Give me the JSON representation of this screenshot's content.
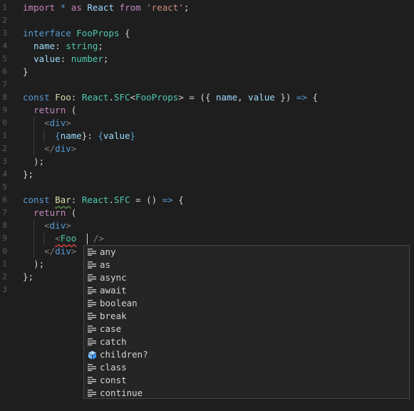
{
  "gutter": {
    "line_numbers": [
      "1",
      "2",
      "3",
      "4",
      "5",
      "6",
      "7",
      "8",
      "9",
      "0",
      "1",
      "2",
      "3",
      "4",
      "5",
      "6",
      "7",
      "8",
      "9",
      "0",
      "1",
      "2",
      "3"
    ]
  },
  "code": {
    "l1": {
      "t1": "import",
      "t2": " ",
      "t3": "*",
      "t4": " ",
      "t5": "as",
      "t6": " React ",
      "t7": "from",
      "t8": " ",
      "t9": "'react'",
      "t10": ";"
    },
    "l3": {
      "t1": "interface",
      "t2": " ",
      "t3": "FooProps",
      "t4": " {"
    },
    "l4": {
      "t1": "  ",
      "t2": "name",
      "t3": ": ",
      "t4": "string",
      "t5": ";"
    },
    "l5": {
      "t1": "  ",
      "t2": "value",
      "t3": ": ",
      "t4": "number",
      "t5": ";"
    },
    "l6": {
      "t1": "}"
    },
    "l8": {
      "t1": "const",
      "t2": " ",
      "t3": "Foo",
      "t4": ": ",
      "t5": "React",
      "t6": ".",
      "t7": "SFC",
      "t8": "<",
      "t9": "FooProps",
      "t10": "> = ({ ",
      "t11": "name",
      "t12": ", ",
      "t13": "value",
      "t14": " }) ",
      "t15": "=>",
      "t16": " {"
    },
    "l9": {
      "t1": "  ",
      "t2": "return",
      "t3": " ("
    },
    "l10": {
      "t1": "    ",
      "t2": "<",
      "t3": "div",
      "t4": ">"
    },
    "l11": {
      "t1": "      ",
      "t2": "{",
      "t3": "name",
      "t4": "}: ",
      "t5": "{",
      "t6": "value",
      "t7": "}"
    },
    "l12": {
      "t1": "    ",
      "t2": "</",
      "t3": "div",
      "t4": ">"
    },
    "l13": {
      "t1": "  );"
    },
    "l14": {
      "t1": "};"
    },
    "l16": {
      "t1": "const",
      "t2": " ",
      "t3": "Bar",
      "t4": ": ",
      "t5": "React",
      "t6": ".",
      "t7": "SFC",
      "t8": " = () ",
      "t9": "=>",
      "t10": " {"
    },
    "l17": {
      "t1": "  ",
      "t2": "return",
      "t3": " ("
    },
    "l18": {
      "t1": "    ",
      "t2": "<",
      "t3": "div",
      "t4": ">"
    },
    "l19": {
      "t1": "      ",
      "t2": "<",
      "t3": "Foo",
      "t4": "  ",
      "t5": " ",
      "t6": "/>"
    },
    "l20": {
      "t1": "    ",
      "t2": "</",
      "t3": "div",
      "t4": ">"
    },
    "l21": {
      "t1": "  );"
    },
    "l22": {
      "t1": "};"
    }
  },
  "suggestions": {
    "items": [
      {
        "label": "any",
        "icon": "keyword-icon"
      },
      {
        "label": "as",
        "icon": "keyword-icon"
      },
      {
        "label": "async",
        "icon": "keyword-icon"
      },
      {
        "label": "await",
        "icon": "keyword-icon"
      },
      {
        "label": "boolean",
        "icon": "keyword-icon"
      },
      {
        "label": "break",
        "icon": "keyword-icon"
      },
      {
        "label": "case",
        "icon": "keyword-icon"
      },
      {
        "label": "catch",
        "icon": "keyword-icon"
      },
      {
        "label": "children?",
        "icon": "property-icon"
      },
      {
        "label": "class",
        "icon": "keyword-icon"
      },
      {
        "label": "const",
        "icon": "keyword-icon"
      },
      {
        "label": "continue",
        "icon": "keyword-icon"
      }
    ]
  },
  "colors": {
    "background": "#1e1e1e",
    "keyword": "#c586c0",
    "storage": "#569cd6",
    "string": "#ce9178",
    "type": "#4ec9b0",
    "variable": "#9cdcfe",
    "property_icon": "#75beff"
  }
}
